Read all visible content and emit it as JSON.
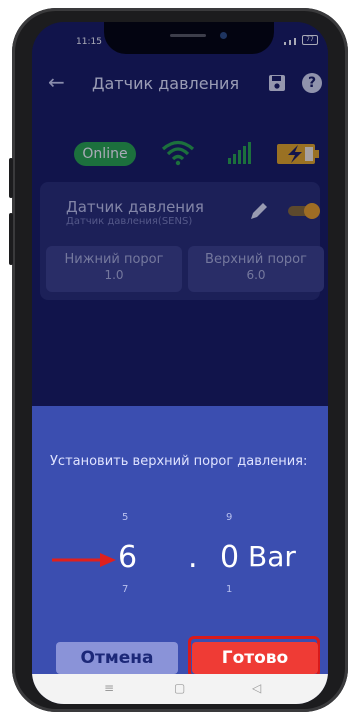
{
  "status_bar": {
    "time": "11:15",
    "battery": "77"
  },
  "app_bar": {
    "title": "Датчик давления",
    "back_icon": "arrow-back-icon",
    "save_icon": "floppy-disk-icon",
    "help_icon": "help-circle-icon",
    "help_glyph": "?"
  },
  "connection": {
    "online_label": "Online",
    "wifi_icon": "wifi-icon",
    "signal_icon": "cell-signal-icon",
    "battery_icon": "battery-charging-icon"
  },
  "sensor_card": {
    "name": "Датчик давления",
    "subtitle": "Датчик давления(SENS)",
    "lower_label": "Нижний порог",
    "lower_value": "1.0",
    "upper_label": "Верхний порог",
    "upper_value": "6.0",
    "edit_icon": "pencil-icon",
    "enabled": true
  },
  "picker_dialog": {
    "prompt": "Установить верхний порог давления:",
    "integer": {
      "prev": "5",
      "current": "6",
      "next": "7"
    },
    "separator": ".",
    "decimal": {
      "prev": "9",
      "current": "0",
      "next": "1"
    },
    "unit": "Bar",
    "cancel_label": "Отмена",
    "ok_label": "Готово"
  },
  "colors": {
    "background": "#161a5a",
    "sheet": "#3b4eb0",
    "online": "#27a644",
    "toggle": "#f0a11e",
    "ok_button": "#ef3b35",
    "highlight": "#d91a1a"
  },
  "nav_bar": {
    "recents_glyph": "≡",
    "home_glyph": "▢",
    "back_glyph": "◁"
  }
}
